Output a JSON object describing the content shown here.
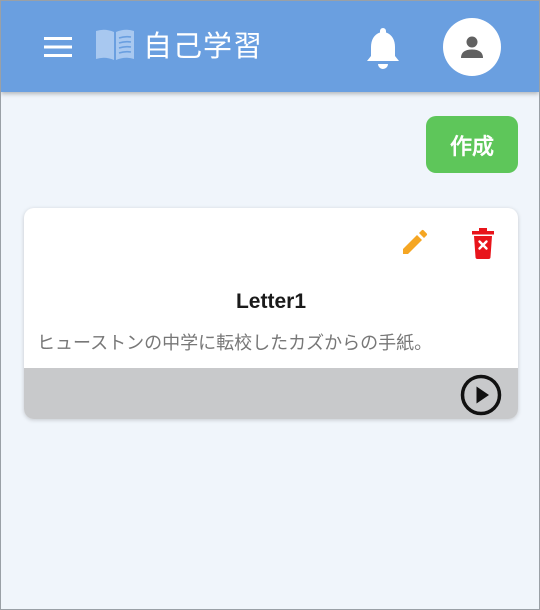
{
  "header": {
    "title": "自己学習",
    "menu_icon": "hamburger-menu-icon",
    "logo_icon": "book-icon",
    "notification_icon": "bell-icon",
    "account_icon": "person-icon",
    "color": "#6a9fe0"
  },
  "actions": {
    "create_label": "作成",
    "create_color": "#5ec65a"
  },
  "cards": [
    {
      "title": "Letter1",
      "description": "ヒューストンの中学に転校したカズからの手紙。",
      "edit_icon": "pencil-icon",
      "delete_icon": "trash-icon",
      "play_icon": "play-circle-icon",
      "edit_color": "#f5a623",
      "delete_color": "#e8141b"
    }
  ]
}
